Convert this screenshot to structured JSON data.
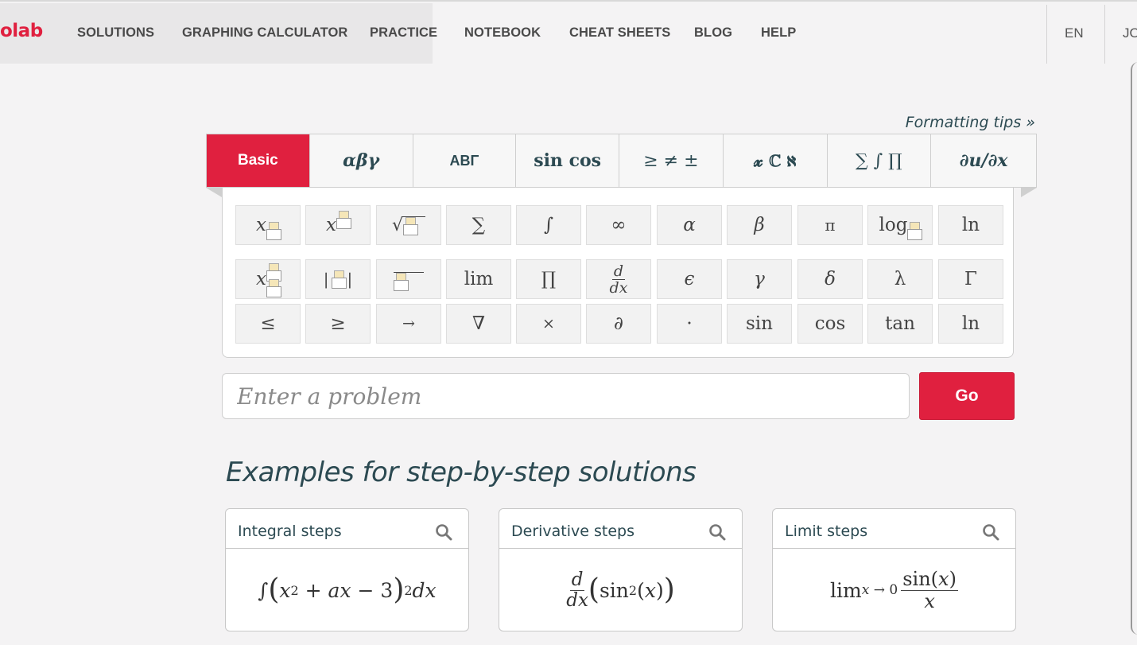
{
  "header": {
    "logo": "olab",
    "nav": [
      "SOLUTIONS",
      "GRAPHING CALCULATOR",
      "PRACTICE",
      "NOTEBOOK",
      "CHEAT SHEETS",
      "BLOG",
      "HELP"
    ],
    "languages": [
      "EN",
      "JO"
    ]
  },
  "formatting_tips": "Formatting tips »",
  "tabs": [
    "Basic",
    "αβγ",
    "ΑΒΓ",
    "sin cos",
    "≥ ≠ ±",
    "𝔁 ℂ ℵ",
    "∑ ∫ ∏",
    "∂u/∂x"
  ],
  "keypad": {
    "row1": [
      "∑",
      "∫",
      "∞",
      "α",
      "β",
      "π",
      "log",
      "ln"
    ],
    "row2": [
      "lim",
      "∏",
      "d",
      "dx",
      "ϵ",
      "γ",
      "δ",
      "λ",
      "Γ"
    ],
    "row3": [
      "≤",
      "≥",
      "→",
      "∇",
      "×",
      "∂",
      "·",
      "sin",
      "cos",
      "tan",
      "ln"
    ],
    "x": "x"
  },
  "input": {
    "placeholder": "Enter a problem"
  },
  "go": "Go",
  "examples": {
    "heading": "Examples for step-by-step solutions",
    "cards": [
      {
        "title": "Integral steps"
      },
      {
        "title": "Derivative steps"
      },
      {
        "title": "Limit steps"
      }
    ]
  },
  "colors": {
    "accent": "#e0203f",
    "heading": "#2c4a52"
  },
  "icons": [
    "search-icon",
    "placeholder-box-icon"
  ]
}
